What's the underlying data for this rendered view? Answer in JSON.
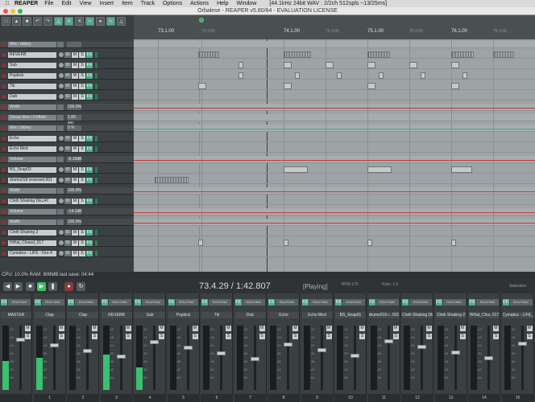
{
  "menubar": {
    "app": "REAPER",
    "items": [
      "File",
      "Edit",
      "View",
      "Insert",
      "Item",
      "Track",
      "Options",
      "Actions",
      "Help",
      "Window"
    ],
    "info": "[44.1kHz 24bit WAV : 2/2ch 512spls ~13/25ms]"
  },
  "window": {
    "title": "Orbalese - REAPER v5.80/64 - EVALUATION LICENSE"
  },
  "toolbar": {
    "icons": [
      "new-icon",
      "open-icon",
      "save-icon",
      "undo-icon",
      "redo-icon",
      "metronome-icon",
      "grid-icon",
      "snap-icon",
      "ripple-icon",
      "lock-icon",
      "envelope-icon",
      "trim-icon"
    ]
  },
  "ruler": {
    "labels": [
      "73.1.00",
      "73.3.00",
      "74.1.00",
      "74.3.00",
      "75.1.00",
      "75.3.00",
      "76.1.00",
      "76.3.00"
    ],
    "marker": "1"
  },
  "tracks": [
    {
      "name": "Wet / drbley",
      "type": "env",
      "value": ""
    },
    {
      "name": "REVERB",
      "type": "track",
      "value": ""
    },
    {
      "name": "Sub",
      "type": "track",
      "value": ""
    },
    {
      "name": "Popkick",
      "type": "track",
      "value": ""
    },
    {
      "name": "Tik",
      "type": "track",
      "value": ""
    },
    {
      "name": "Dub",
      "type": "track",
      "value": ""
    },
    {
      "name": "Width",
      "type": "env",
      "value": "100.0%"
    },
    {
      "name": "Decay time / Drifbier",
      "type": "env",
      "value": "1.83 sec"
    },
    {
      "name": "Wet / drbley",
      "type": "env",
      "value": "0 %"
    },
    {
      "name": "Echo",
      "type": "track",
      "value": ""
    },
    {
      "name": "Echo Med",
      "type": "track",
      "value": ""
    },
    {
      "name": "Volume",
      "type": "env",
      "value": "-6.10dB"
    },
    {
      "name": "BS_Snap03",
      "type": "track",
      "value": ""
    },
    {
      "name": "drums018 reversed 001",
      "type": "track",
      "value": ""
    },
    {
      "name": "Width",
      "type": "env",
      "value": "100.0%"
    },
    {
      "name": "Cloth Shaking DELAY",
      "type": "track",
      "value": ""
    },
    {
      "name": "Volume",
      "type": "env",
      "value": "-14.1dB"
    },
    {
      "name": "Width",
      "type": "env",
      "value": "100.0%"
    },
    {
      "name": "Cloth Shaking 2",
      "type": "track",
      "value": ""
    },
    {
      "name": "HiHat_Closed_017",
      "type": "track",
      "value": ""
    },
    {
      "name": "Cymatics - LIFE - Fire 4",
      "type": "track",
      "value": ""
    }
  ],
  "trackButtons": {
    "io": "IO",
    "m": "M",
    "s": "S",
    "fx": "FX"
  },
  "status": {
    "text": "CPU: 10.0%  RAM: 909MB  last save: 04:44"
  },
  "transport": {
    "timecode": "73.4.29 / 1:42.807",
    "state": "[Playing]",
    "bpm": "BPM\n170",
    "sig": "4/4",
    "rate": "Rate:   1.0",
    "selection": "Selection:"
  },
  "mixer": {
    "routing": "ROUTING",
    "fx": "FX",
    "strips": [
      {
        "name": "MASTER",
        "num": "",
        "level": 0.45
      },
      {
        "name": "Clap",
        "num": "1",
        "level": 0.5
      },
      {
        "name": "Clap",
        "num": "2",
        "level": 0.0
      },
      {
        "name": "REVERB",
        "num": "3",
        "level": 0.55
      },
      {
        "name": "Sub",
        "num": "4",
        "level": 0.35
      },
      {
        "name": "Popkick",
        "num": "5",
        "level": 0.0
      },
      {
        "name": "Tik",
        "num": "6",
        "level": 0.0
      },
      {
        "name": "Dub",
        "num": "7",
        "level": 0.0
      },
      {
        "name": "Echo",
        "num": "8",
        "level": 0.0
      },
      {
        "name": "Echo Med",
        "num": "9",
        "level": 0.0
      },
      {
        "name": "BS_Snap01",
        "num": "10",
        "level": 0.0
      },
      {
        "name": "drums018 r...001",
        "num": "11",
        "level": 0.0
      },
      {
        "name": "Cloth Shaking DE",
        "num": "12",
        "level": 0.0
      },
      {
        "name": "Cloth Shaking 2",
        "num": "13",
        "level": 0.0
      },
      {
        "name": "HiHat_Clos..017",
        "num": "14",
        "level": 0.0
      },
      {
        "name": "Cymatics - LIFE_4",
        "num": "15",
        "level": 0.0
      }
    ],
    "scale": [
      "-12",
      "-18",
      "-24",
      "-30",
      "-36",
      "-42",
      "-54"
    ]
  },
  "dock": {
    "label": "Mixer"
  }
}
